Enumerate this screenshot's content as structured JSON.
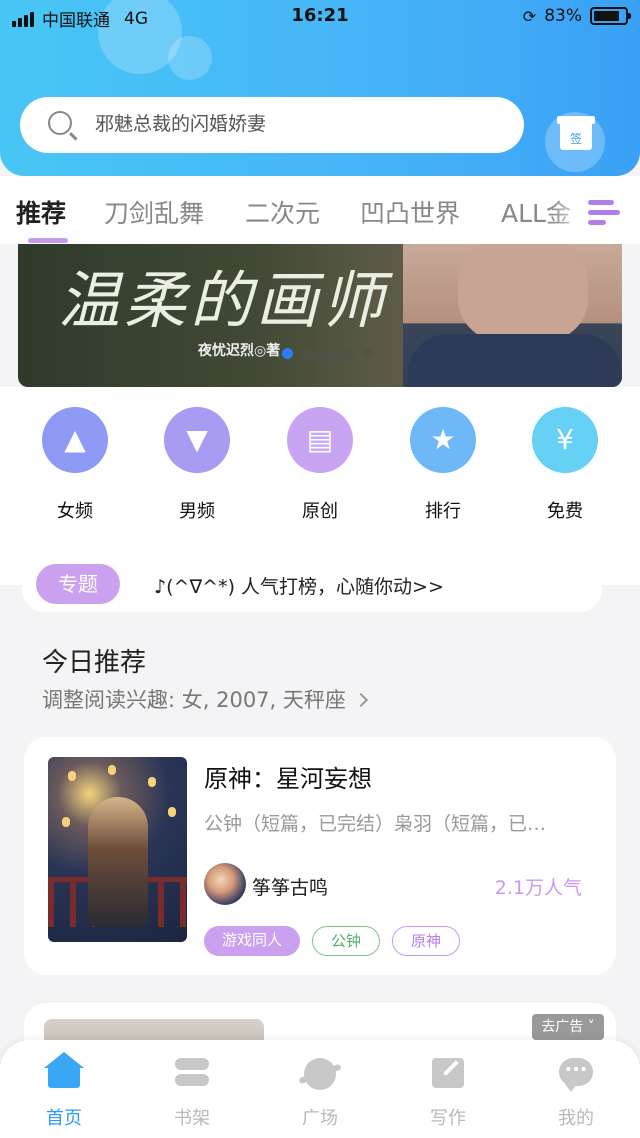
{
  "status_bar": {
    "carrier": "中国联通",
    "network": "4G",
    "time": "16:21",
    "battery": "83%",
    "battery_level": 0.83
  },
  "search": {
    "placeholder": "邪魅总裁的闪婚娇妻"
  },
  "gift": {
    "label": "签"
  },
  "tabs": [
    {
      "label": "推荐",
      "active": true
    },
    {
      "label": "刀剑乱舞"
    },
    {
      "label": "二次元"
    },
    {
      "label": "凹凸世界"
    },
    {
      "label": "ALL金"
    }
  ],
  "banner": {
    "title": "温柔的画师",
    "author": "夜忧迟烈◎著",
    "dot_count": 5,
    "active_dot": 0
  },
  "categories": [
    {
      "label": "女频",
      "icon": "dress-icon",
      "color": "#8f9af5"
    },
    {
      "label": "男频",
      "icon": "shirt-icon",
      "color": "#a79bf2"
    },
    {
      "label": "原创",
      "icon": "book-icon",
      "color": "#c8a5f3"
    },
    {
      "label": "排行",
      "icon": "trophy-icon",
      "color": "#6fb8f7"
    },
    {
      "label": "免费",
      "icon": "coin-icon",
      "color": "#67d0f5"
    }
  ],
  "topic": {
    "badge": "专题",
    "text": "♪(^∇^*) 人气打榜，心随你动>>"
  },
  "today": {
    "title": "今日推荐",
    "subtitle": "调整阅读兴趣: 女, 2007, 天秤座"
  },
  "book": {
    "title": "原神：星河妄想",
    "description": "公钟（短篇，已完结）枭羽（短篇，已…",
    "author": "筝筝古鸣",
    "popularity": "2.1万人气",
    "tags": [
      "游戏同人",
      "公钟",
      "原神"
    ]
  },
  "ad": {
    "label": "去广告 ˅"
  },
  "bottom_nav": [
    {
      "label": "首页",
      "icon": "home-icon",
      "active": true
    },
    {
      "label": "书架",
      "icon": "bookshelf-icon"
    },
    {
      "label": "广场",
      "icon": "planet-icon"
    },
    {
      "label": "写作",
      "icon": "pen-icon"
    },
    {
      "label": "我的",
      "icon": "chat-icon"
    }
  ]
}
